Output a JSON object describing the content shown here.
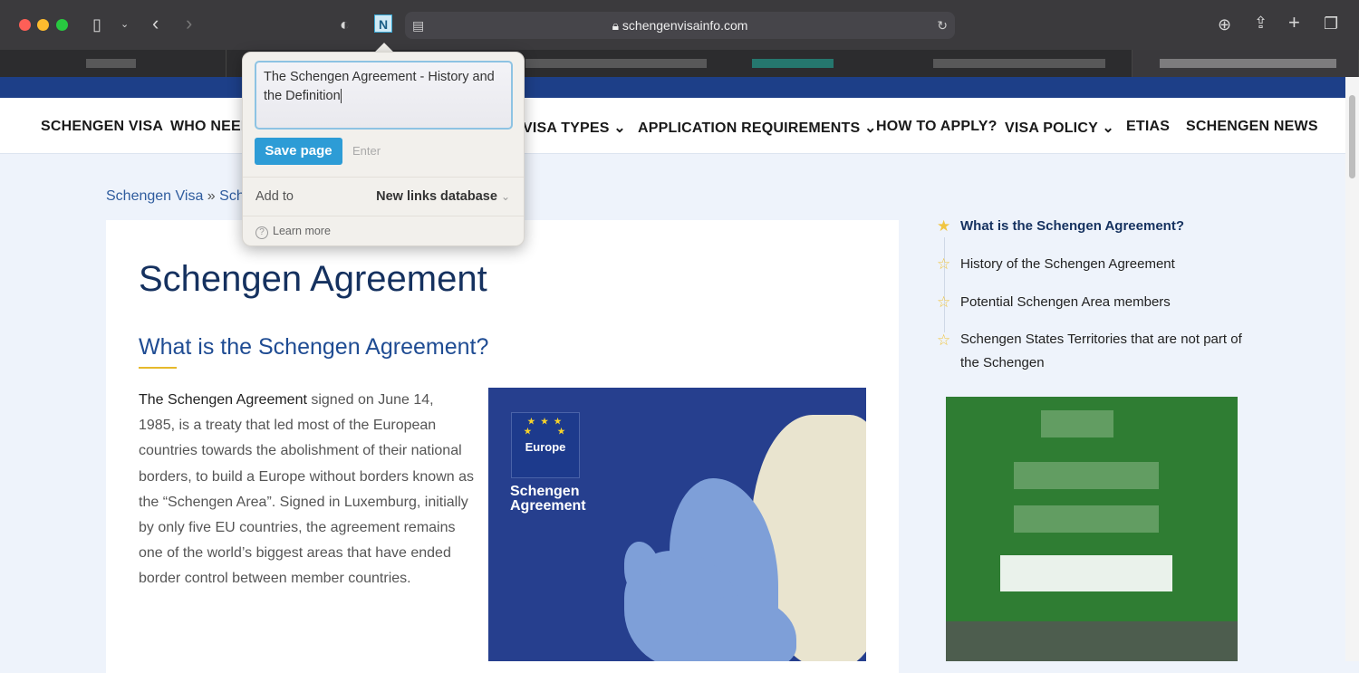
{
  "browser": {
    "url": "schengenvisainfo.com"
  },
  "nav": {
    "items": [
      "SCHENGEN VISA",
      "WHO NEED",
      "VISA TYPES",
      "APPLICATION REQUIREMENTS",
      "HOW TO APPLY?",
      "VISA POLICY",
      "ETIAS",
      "SCHENGEN NEWS"
    ]
  },
  "breadcrumb": {
    "home": "Schengen Visa",
    "sep": "»",
    "current": "Sch"
  },
  "article": {
    "title": "Schengen Agreement",
    "heading": "What is the Schengen Agreement?",
    "lead_bold": "The Schengen Agreement",
    "body": " signed on June 14, 1985, is a treaty that led most of the European countries towards the abolishment of their national borders, to build a Europe without borders known as the “Schengen Area”. Signed in Luxemburg, initially by only five EU countries, the agreement remains one of the world’s biggest areas that have ended border control between member countries."
  },
  "map": {
    "badge": "Europe",
    "title_line1": "Schengen",
    "title_line2": "Agreement"
  },
  "toc": [
    {
      "label": "What is the Schengen Agreement?",
      "active": true
    },
    {
      "label": "History of the Schengen Agreement"
    },
    {
      "label": "Potential Schengen Area members"
    },
    {
      "label": "Schengen States Territories that are not part of the Schengen"
    }
  ],
  "popup": {
    "title_value": "The Schengen Agreement - History and the Definition",
    "save_label": "Save page",
    "shortcut": "Enter",
    "add_to_label": "Add to",
    "database": "New links database",
    "learn_more": "Learn more"
  },
  "colors": {
    "accent": "#2d9cd6",
    "brand": "#1d3f88"
  }
}
